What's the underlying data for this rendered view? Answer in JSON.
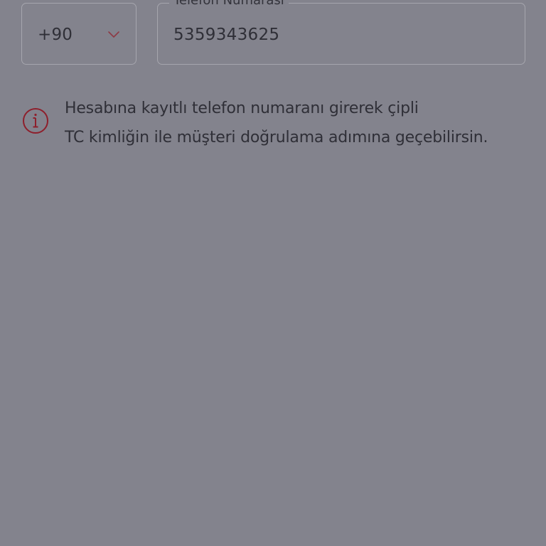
{
  "country_select": {
    "value": "+90",
    "icon": "chevron-down-icon"
  },
  "phone_field": {
    "label": "Telefon Numarası",
    "value": "5359343625"
  },
  "info_message": {
    "icon": "info-icon",
    "line1": "Hesabına kayıtlı telefon numaranı girerek çipli",
    "line2": "TC kimliğin ile müşteri doğrulama adımına geçebilirsin."
  },
  "colors": {
    "overlay_background": "#83838d",
    "field_border": "#a6a6ae",
    "accent_red": "#8e1f2c",
    "text": "#2f2f37"
  }
}
